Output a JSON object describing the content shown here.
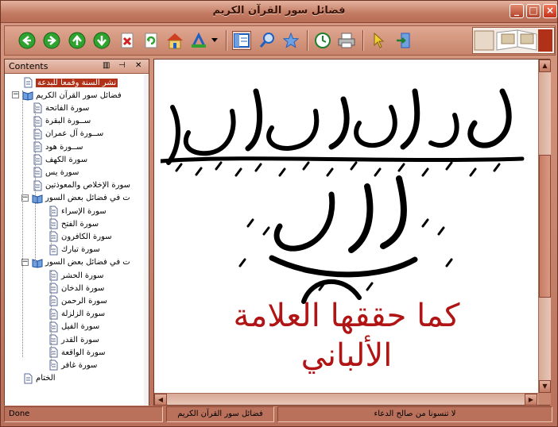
{
  "window": {
    "title": "فضائل سور القرآن الكريم",
    "controls": {
      "minimize": "_",
      "maximize": "□",
      "close": "×"
    }
  },
  "toolbar": {
    "buttons": [
      {
        "name": "back",
        "icon": "arrow-left-icon",
        "color": "#2fa22f"
      },
      {
        "name": "forward",
        "icon": "arrow-right-icon",
        "color": "#2fa22f"
      },
      {
        "name": "up",
        "icon": "arrow-up-icon",
        "color": "#2fa22f"
      },
      {
        "name": "down",
        "icon": "arrow-down-icon",
        "color": "#2fa22f"
      },
      {
        "name": "stop",
        "icon": "stop-icon",
        "color": "#d02020"
      },
      {
        "name": "refresh",
        "icon": "refresh-icon",
        "color": "#2fa22f"
      },
      {
        "name": "home",
        "icon": "home-icon",
        "color": "#e0a020"
      },
      {
        "name": "font",
        "icon": "font-size-icon",
        "color": "#2060c0"
      },
      {
        "name": "hide-contents",
        "icon": "contents-pane-icon",
        "color": "#2060c0"
      },
      {
        "name": "search",
        "icon": "search-icon",
        "color": "#2060c0"
      },
      {
        "name": "favorites",
        "icon": "star-icon",
        "color": "#2060c0"
      },
      {
        "name": "history",
        "icon": "history-icon",
        "color": "#2fa22f"
      },
      {
        "name": "print",
        "icon": "printer-icon",
        "color": "#606060"
      },
      {
        "name": "options",
        "icon": "pointer-icon",
        "color": "#e0c020"
      },
      {
        "name": "exit",
        "icon": "exit-icon",
        "color": "#2060c0"
      }
    ]
  },
  "contents_pane": {
    "title": "Contents",
    "icons": [
      "pane-menu-icon",
      "pin-icon",
      "close-icon"
    ],
    "items": [
      {
        "label": "نشر السنة وقمعا للبدعة",
        "level": 0,
        "type": "page",
        "selected": true
      },
      {
        "label": "فضائل سور القرآن الكريم",
        "level": 0,
        "type": "book",
        "expanded": true
      },
      {
        "label": "سورة الفاتحة",
        "level": 1,
        "type": "page"
      },
      {
        "label": "ســورة البقرة",
        "level": 1,
        "type": "page"
      },
      {
        "label": "ســورة آل عمران",
        "level": 1,
        "type": "page"
      },
      {
        "label": "ســورة هود",
        "level": 1,
        "type": "page"
      },
      {
        "label": "سورة الكهف",
        "level": 1,
        "type": "page"
      },
      {
        "label": "سورة يس",
        "level": 1,
        "type": "page"
      },
      {
        "label": "سورة الإخلاص والمعوذتين",
        "level": 1,
        "type": "page"
      },
      {
        "label": "ت في فضائل بعض السور",
        "level": 1,
        "type": "book",
        "expanded": true
      },
      {
        "label": "سورة الإسراء",
        "level": 2,
        "type": "page"
      },
      {
        "label": "سورة الفتح",
        "level": 2,
        "type": "page"
      },
      {
        "label": "سورة الكافرون",
        "level": 2,
        "type": "page"
      },
      {
        "label": "سورة تبارك",
        "level": 2,
        "type": "page"
      },
      {
        "label": "ت في فضائل بعض السور",
        "level": 1,
        "type": "book",
        "expanded": true
      },
      {
        "label": "سورة الحشر",
        "level": 2,
        "type": "page"
      },
      {
        "label": "سورة الدخان",
        "level": 2,
        "type": "page"
      },
      {
        "label": "سورة الرحمن",
        "level": 2,
        "type": "page"
      },
      {
        "label": "سورة الزلزلة",
        "level": 2,
        "type": "page"
      },
      {
        "label": "سورة الفيل",
        "level": 2,
        "type": "page"
      },
      {
        "label": "سورة القدر",
        "level": 2,
        "type": "page"
      },
      {
        "label": "سورة الواقعة",
        "level": 2,
        "type": "page"
      },
      {
        "label": "سورة غافر",
        "level": 2,
        "type": "page"
      },
      {
        "label": "الختام",
        "level": 0,
        "type": "page"
      }
    ]
  },
  "content": {
    "calligraphy_title": "فضائل سور القرآن الكريم",
    "subtitle_line1": "كما حققها العلامة",
    "subtitle_line2": "الألباني",
    "accent_color": "#b01414"
  },
  "statusbar": {
    "status": "Done",
    "book_title": "فضائل سور القرآن الكريم",
    "message": "لا تنسونا من صالح الدعاء"
  }
}
